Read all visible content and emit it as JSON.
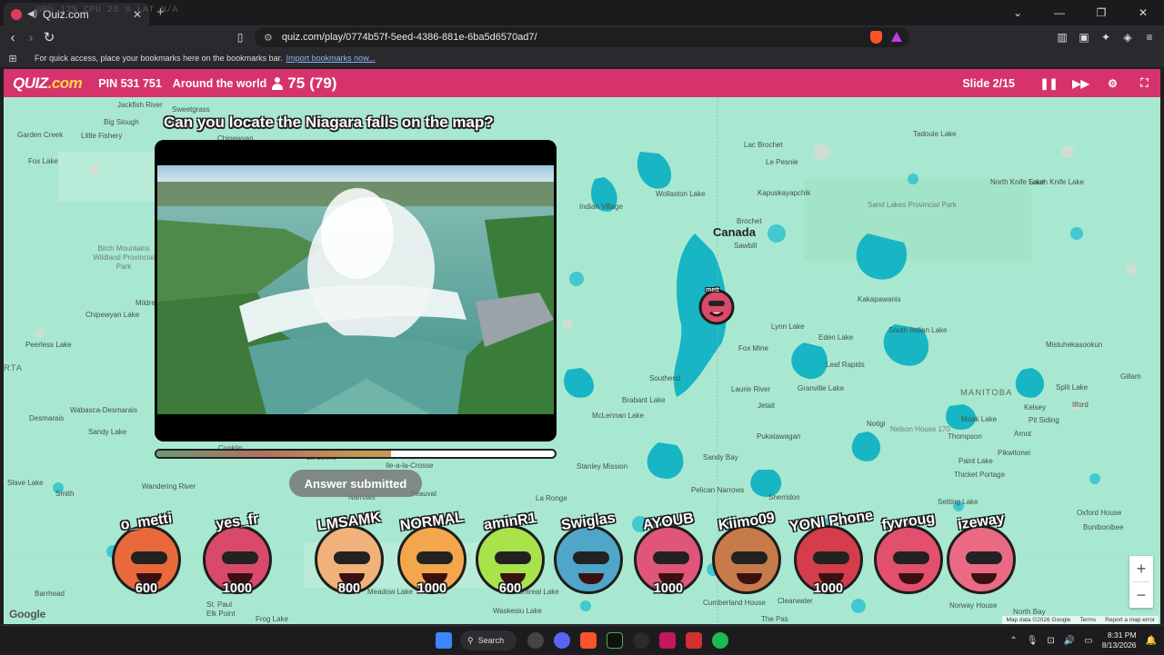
{
  "browser": {
    "tab_title": "Quiz.com",
    "perf_overlay": "GPU  12%    CPU  25 %    LAT  N/A",
    "url": "quiz.com/play/0774b57f-5eed-4386-881e-6ba5d6570ad7/",
    "bookmarks_text": "For quick access, place your bookmarks here on the bookmarks bar.",
    "bookmarks_link": "Import bookmarks now..."
  },
  "header": {
    "logo": "QUIZ",
    "logo_suffix": ".com",
    "pin": "PIN 531 751",
    "room": "Around the world",
    "players_answered": "75",
    "players_total": "(79)",
    "slide": "Slide 2/15"
  },
  "question": {
    "text": "Can you locate the Niagara falls on the map?",
    "answer_status": "Answer submitted",
    "timer_progress_pct": 59
  },
  "map": {
    "country_label": "Canada",
    "province_label": "MANITOBA",
    "partial_label": "RTA",
    "marker_label": "mett",
    "places": [
      {
        "name": "Jackfish River"
      },
      {
        "name": "Sweetgrass"
      },
      {
        "name": "Big Slough"
      },
      {
        "name": "Garden Creek"
      },
      {
        "name": "Little Fishery"
      },
      {
        "name": "Chipewyan"
      },
      {
        "name": "Fox Lake"
      },
      {
        "name": "Peerless Lake"
      },
      {
        "name": "Chipewyan Lake"
      },
      {
        "name": "Wabasca-Desmarais"
      },
      {
        "name": "Desmarais"
      },
      {
        "name": "Sandy Lake"
      },
      {
        "name": "Conklin"
      },
      {
        "name": "Wandering River"
      },
      {
        "name": "Smith"
      },
      {
        "name": "Slave Lake"
      },
      {
        "name": "Barrhead"
      },
      {
        "name": "St. Paul"
      },
      {
        "name": "Elk Point"
      },
      {
        "name": "Frog Lake"
      },
      {
        "name": "Mildred"
      },
      {
        "name": "La Loche"
      },
      {
        "name": "Ile-a-la-Crosse"
      },
      {
        "name": "Beauval"
      },
      {
        "name": "Narrows"
      },
      {
        "name": "La Ronge"
      },
      {
        "name": "Meadow Lake"
      },
      {
        "name": "Montreal Lake"
      },
      {
        "name": "Waskesiu Lake"
      },
      {
        "name": "Stanley Mission"
      },
      {
        "name": "McLennan Lake"
      },
      {
        "name": "Southend"
      },
      {
        "name": "Brabant Lake"
      },
      {
        "name": "Laurie River"
      },
      {
        "name": "Jetait"
      },
      {
        "name": "Pukatawagan"
      },
      {
        "name": "Sandy Bay"
      },
      {
        "name": "Pelican Narrows"
      },
      {
        "name": "Sherridon"
      },
      {
        "name": "Cumberland House"
      },
      {
        "name": "Clearwater"
      },
      {
        "name": "The Pas"
      },
      {
        "name": "Indian Village"
      },
      {
        "name": "Wollaston Lake"
      },
      {
        "name": "Brochet"
      },
      {
        "name": "Sawbill"
      },
      {
        "name": "Lac Brochet"
      },
      {
        "name": "Le Pesnie"
      },
      {
        "name": "Kapuskayapchik"
      },
      {
        "name": "Tadoule Lake"
      },
      {
        "name": "North Knife Lake"
      },
      {
        "name": "South Knife Lake"
      },
      {
        "name": "Sand Lakes Provincial Park"
      },
      {
        "name": "Kakapawanis"
      },
      {
        "name": "Lynn Lake"
      },
      {
        "name": "Fox Mine"
      },
      {
        "name": "Eden Lake"
      },
      {
        "name": "South Indian Lake"
      },
      {
        "name": "Leaf Rapids"
      },
      {
        "name": "Granville Lake"
      },
      {
        "name": "Mistuhekasookun"
      },
      {
        "name": "Gillam"
      },
      {
        "name": "Split Lake"
      },
      {
        "name": "Kelsey"
      },
      {
        "name": "Ilford"
      },
      {
        "name": "Pit Siding"
      },
      {
        "name": "Moak Lake"
      },
      {
        "name": "Notigi"
      },
      {
        "name": "Nelson House 170"
      },
      {
        "name": "Thompson"
      },
      {
        "name": "Arnot"
      },
      {
        "name": "Pikwitonei"
      },
      {
        "name": "Paint Lake"
      },
      {
        "name": "Thicket Portage"
      },
      {
        "name": "Setting Lake"
      },
      {
        "name": "Oxford House"
      },
      {
        "name": "Bunibonibee"
      },
      {
        "name": "Norway House"
      },
      {
        "name": "North Bay"
      },
      {
        "name": "Birch Mountains Wildland Provincial Park"
      }
    ],
    "attribution": "Map data ©2026 Google",
    "terms": "Terms",
    "report": "Report a map error",
    "logo": "Google",
    "zoom_in": "+",
    "zoom_out": "−"
  },
  "players": [
    {
      "name": "o_metti",
      "score": "600",
      "color": "#e86a3c"
    },
    {
      "name": "yes_fr",
      "score": "1000",
      "color": "#d94a6a"
    },
    {
      "name": "LMSAMK",
      "score": "800",
      "color": "#f0b27a"
    },
    {
      "name": "NORMAL",
      "score": "1000",
      "color": "#f3a64c"
    },
    {
      "name": "aminR1",
      "score": "600",
      "color": "#a8e34b"
    },
    {
      "name": "Swiglas",
      "score": "",
      "color": "#4fa6c9"
    },
    {
      "name": "AYOUB",
      "score": "1000",
      "color": "#e0567a"
    },
    {
      "name": "Kiimo09",
      "score": "",
      "color": "#c87b4a"
    },
    {
      "name": "YONI Phone",
      "score": "1000",
      "color": "#d43d4a"
    },
    {
      "name": "fyvroug",
      "score": "",
      "color": "#e2506e"
    },
    {
      "name": "izeway",
      "score": "",
      "color": "#ea6a84"
    }
  ],
  "taskbar": {
    "search": "Search",
    "time": "8:31 PM",
    "date": "8/13/2026"
  }
}
